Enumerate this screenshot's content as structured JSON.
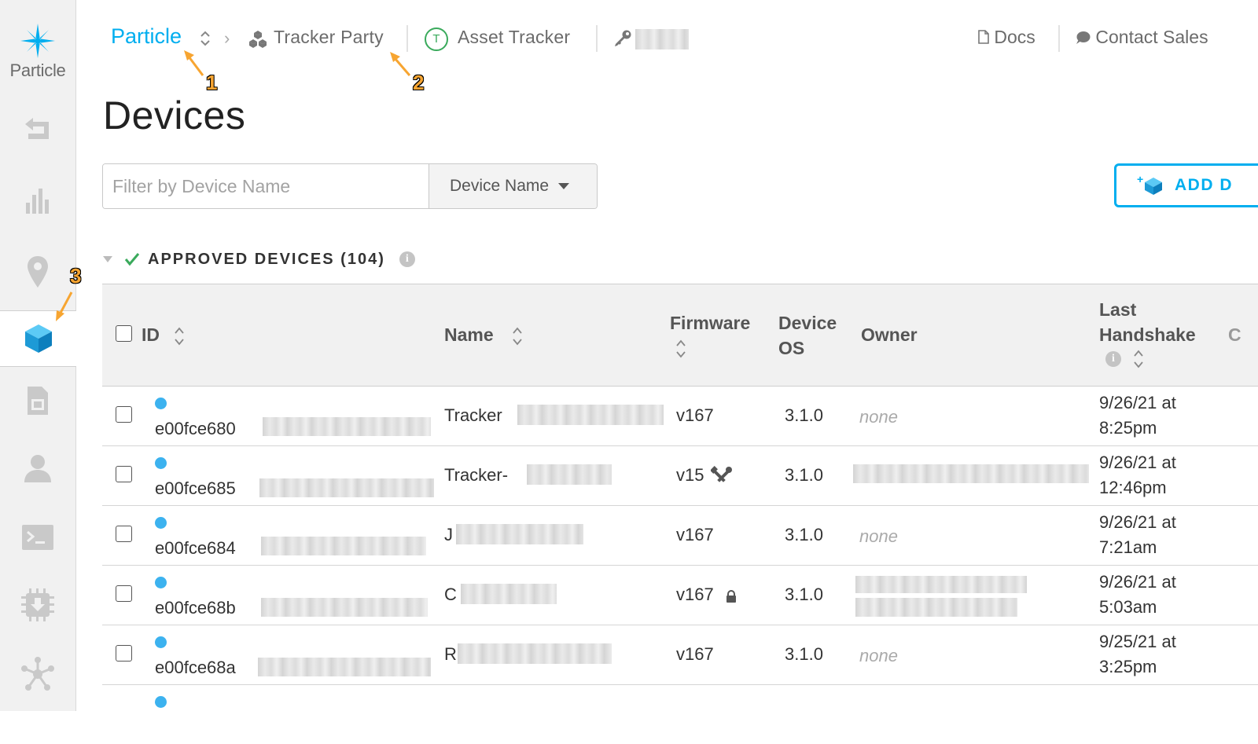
{
  "sidebar": {
    "logo_label": "Particle",
    "items": [
      {
        "icon": "back-arrow-icon"
      },
      {
        "icon": "bar-chart-icon"
      },
      {
        "icon": "map-pin-icon"
      },
      {
        "icon": "cube-icon",
        "active": true
      },
      {
        "icon": "sim-card-icon"
      },
      {
        "icon": "user-icon"
      },
      {
        "icon": "terminal-icon"
      },
      {
        "icon": "firmware-chip-icon"
      },
      {
        "icon": "network-icon"
      }
    ]
  },
  "topbar": {
    "org": "Particle",
    "product": "Tracker Party",
    "product_type_badge": "T",
    "product_type": "Asset Tracker",
    "docs": "Docs",
    "contact": "Contact Sales"
  },
  "annotations": [
    "1",
    "2",
    "3"
  ],
  "page": {
    "title": "Devices",
    "filter_placeholder": "Filter by Device Name",
    "filter_select": "Device Name",
    "add_button": "ADD D"
  },
  "section": {
    "title": "APPROVED DEVICES (104)"
  },
  "table": {
    "headers": {
      "id": "ID",
      "name": "Name",
      "firmware": "Firmware",
      "device_os_line1": "Device",
      "device_os_line2": "OS",
      "owner": "Owner",
      "handshake_line1": "Last",
      "handshake_line2": "Handshake"
    },
    "rows": [
      {
        "id": "e00fce680",
        "name": "Tracker",
        "firmware": "v167",
        "fw_icon": "",
        "os": "3.1.0",
        "owner": "none",
        "hs1": "9/26/21 at",
        "hs2": "8:25pm"
      },
      {
        "id": "e00fce685",
        "name": "Tracker-",
        "firmware": "v15",
        "fw_icon": "tools-icon",
        "os": "3.1.0",
        "owner": "",
        "hs1": "9/26/21 at",
        "hs2": "12:46pm"
      },
      {
        "id": "e00fce684",
        "name": "J",
        "firmware": "v167",
        "fw_icon": "",
        "os": "3.1.0",
        "owner": "none",
        "hs1": "9/26/21 at",
        "hs2": "7:21am"
      },
      {
        "id": "e00fce68b",
        "name": "C",
        "firmware": "v167",
        "fw_icon": "lock-icon",
        "os": "3.1.0",
        "owner": "",
        "hs1": "9/26/21 at",
        "hs2": "5:03am"
      },
      {
        "id": "e00fce68a",
        "name": "R",
        "firmware": "v167",
        "fw_icon": "",
        "os": "3.1.0",
        "owner": "none",
        "hs1": "9/25/21 at",
        "hs2": "3:25pm"
      }
    ]
  },
  "colors": {
    "accent": "#00aeef",
    "online": "#3cb2ef",
    "approved_check": "#3aaa5c",
    "annotation": "#f7a531"
  }
}
